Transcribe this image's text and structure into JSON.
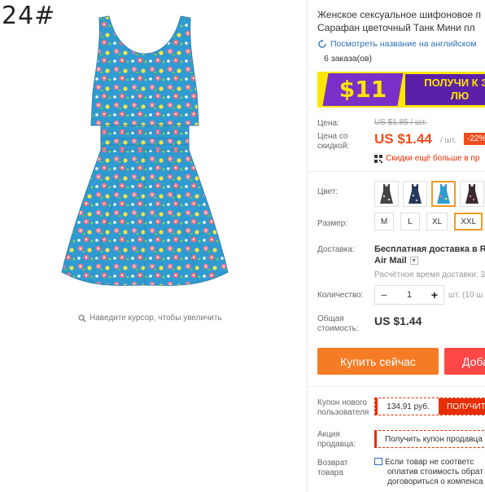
{
  "sku_label": "24#",
  "image": {
    "zoom_hint": "Наведите курсор, чтобы увеличить"
  },
  "product": {
    "title_line1": "Женское сексуальное шифоновое п",
    "title_line2": "Сарафан цветочный Танк Мини пл",
    "translate_link": "Посмотреть название на английском",
    "orders": "6 заказа(ов)"
  },
  "banner": {
    "price": "$11",
    "text": "ПОЛУЧИ К ЗА ЛЮ"
  },
  "price": {
    "label_price": "Цена:",
    "old": "US $1.85 / шт.",
    "label_discount_line1": "Цена со",
    "label_discount_line2": "скидкой:",
    "current": "US $1.44",
    "unit": "/ шт.",
    "discount_badge": "-22%",
    "app_discount": "Скидки ещё больше в пр"
  },
  "options": {
    "color_label": "Цвет:",
    "color_swatches": [
      "black-floral",
      "navy-floral",
      "blue-floral",
      "dark-floral"
    ],
    "color_selected_index": 2,
    "size_label": "Размер:",
    "sizes": [
      "M",
      "L",
      "XL",
      "XXL"
    ],
    "size_selected_index": 3
  },
  "shipping": {
    "label": "Доставка:",
    "title": "Бесплатная доставка в Rus",
    "method": "Air Mail",
    "time": "Расчётное время доставки: 3"
  },
  "quantity": {
    "label": "Количество:",
    "value": "1",
    "minus": "−",
    "plus": "+",
    "note": "шт. (10 ш"
  },
  "total": {
    "label_line1": "Общая",
    "label_line2": "стоимость:",
    "value": "US $1.44"
  },
  "actions": {
    "buy_now": "Купить сейчас",
    "add_cart": "Доба"
  },
  "coupons": {
    "new_user_label_line1": "Купон нового",
    "new_user_label_line2": "пользователя",
    "new_user_amount": "134,91 руб.",
    "new_user_get": "ПОЛУЧИТ",
    "seller_label_line1": "Акция",
    "seller_label_line2": "продавца:",
    "seller_get": "Получить купон продавца"
  },
  "returns": {
    "label_line1": "Возврат",
    "label_line2": "товара",
    "line1": "Если товар не соответс",
    "line2": "оплатив стоимость обрат",
    "line3": "договориться о компенса"
  },
  "colors": {
    "accent_orange": "#f57c24",
    "accent_red": "#e62e04",
    "price_red": "#f04c1c",
    "selected_border": "#f39a23",
    "link_blue": "#2a6fb5",
    "banner_yellow": "#ffe600",
    "banner_purple": "#5b1fa8"
  }
}
